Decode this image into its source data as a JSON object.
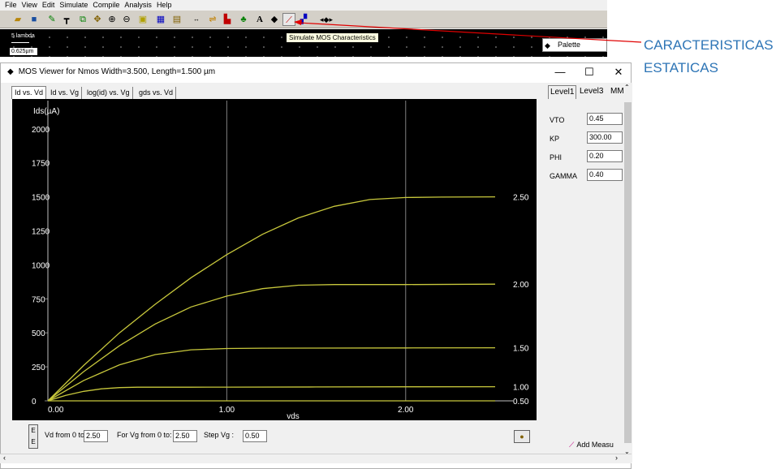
{
  "menu": [
    "File",
    "View",
    "Edit",
    "Simulate",
    "Compile",
    "Analysis",
    "Help"
  ],
  "editor": {
    "scale_label": "5 lambda",
    "size_label": "0.625µm",
    "tooltip": "Simulate MOS Characteristics",
    "palette_label": "Palette"
  },
  "annotation": {
    "line1": "CARACTERISTICAS",
    "line2": "ESTATICAS",
    "color": "#2e75b6",
    "arrow_color": "#e00000"
  },
  "window": {
    "title": "MOS Viewer for Nmos Width=3.500, Length=1.500 µm",
    "minimize": "—",
    "maximize": "☐",
    "close": "✕",
    "tabs": [
      "Id vs. Vd",
      "Id vs. Vg",
      "log(id) vs. Vg",
      "gds vs. Vd"
    ],
    "right_tabs": [
      "Level1",
      "Level3",
      "MM"
    ],
    "params": [
      {
        "label": "VTO",
        "value": "0.45"
      },
      {
        "label": "KP",
        "value": "300.00"
      },
      {
        "label": "PHI",
        "value": "0.20"
      },
      {
        "label": "GAMMA",
        "value": "0.40"
      }
    ],
    "bottom": {
      "vd_label": "Vd from 0 to",
      "vd_value": "2.50",
      "vg_label": "For Vg from 0 to:",
      "vg_value": "2.50",
      "step_label": "Step Vg :",
      "step_value": "0.50"
    },
    "add_measure": "Add Measu"
  },
  "chart_data": {
    "type": "line",
    "ylabel": "Ids(µA)",
    "xlabel": "vds",
    "xlim": [
      0,
      2.6
    ],
    "ylim": [
      0,
      2100
    ],
    "x_ticks": [
      "0.00",
      "1.00",
      "2.00"
    ],
    "y_ticks": [
      "0",
      "250",
      "500",
      "750",
      "1000",
      "1250",
      "1500",
      "1750",
      "2000"
    ],
    "grid": true,
    "series_color": "#c8c83c",
    "series": [
      {
        "name": "0.50",
        "x": [
          0,
          2.5
        ],
        "y": [
          0,
          0
        ]
      },
      {
        "name": "1.00",
        "x": [
          0,
          0.1,
          0.2,
          0.3,
          0.4,
          0.5,
          0.6,
          0.8,
          1.0,
          1.5,
          2.0,
          2.5
        ],
        "y": [
          0,
          40,
          70,
          88,
          97,
          100,
          100,
          100,
          101,
          102,
          103,
          104
        ]
      },
      {
        "name": "1.50",
        "x": [
          0,
          0.2,
          0.4,
          0.6,
          0.8,
          1.0,
          1.2,
          1.5,
          2.0,
          2.5
        ],
        "y": [
          0,
          150,
          265,
          340,
          375,
          385,
          387,
          388,
          389,
          390
        ]
      },
      {
        "name": "2.00",
        "x": [
          0,
          0.2,
          0.4,
          0.6,
          0.8,
          1.0,
          1.2,
          1.4,
          1.6,
          2.0,
          2.5
        ],
        "y": [
          0,
          215,
          405,
          565,
          690,
          770,
          825,
          850,
          855,
          855,
          858
        ]
      },
      {
        "name": "2.50",
        "x": [
          0,
          0.2,
          0.4,
          0.6,
          0.8,
          1.0,
          1.2,
          1.4,
          1.6,
          1.8,
          2.0,
          2.2,
          2.5
        ],
        "y": [
          0,
          260,
          500,
          710,
          905,
          1075,
          1225,
          1345,
          1430,
          1480,
          1495,
          1498,
          1500
        ]
      }
    ]
  }
}
